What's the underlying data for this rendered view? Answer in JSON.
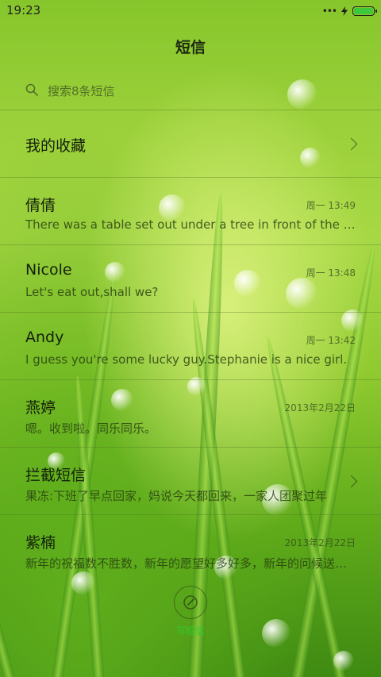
{
  "status_bar": {
    "time": "19:23",
    "signal_icon": "signal-dots-icon",
    "charging_icon": "bolt-icon",
    "battery_icon": "battery-icon",
    "battery_level": 1.0
  },
  "header": {
    "title": "短信"
  },
  "search": {
    "placeholder": "搜索8条短信",
    "value": "",
    "icon": "search-icon"
  },
  "favorites": {
    "label": "我的收藏",
    "icon": "chevron-right-icon"
  },
  "threads": [
    {
      "name": "倩倩",
      "time": "周一 13:49",
      "preview": "There was a table set out under a tree in front of the house"
    },
    {
      "name": "Nicole",
      "time": "周一 13:48",
      "preview": "Let's eat out,shall we?"
    },
    {
      "name": "Andy",
      "time": "周一 13:42",
      "preview": "I guess you're some lucky guy.Stephanie is a nice girl."
    },
    {
      "name": "燕婷",
      "time": "2013年2月22日",
      "preview": "嗯。收到啦。同乐同乐。"
    },
    {
      "name": "拦截短信",
      "time": "",
      "preview": "果冻:下班了早点回家，妈说今天都回来，一家人团聚过年",
      "has_chevron": true
    },
    {
      "name": "紫楠",
      "time": "2013年2月22日",
      "preview": "新年的祝福数不胜数，新年的愿望好多好多，新年的问候送给你"
    }
  ],
  "compose": {
    "label": "写短信",
    "icon": "compose-icon"
  },
  "colors": {
    "accent": "#2ec82a",
    "text": "#14200a"
  }
}
